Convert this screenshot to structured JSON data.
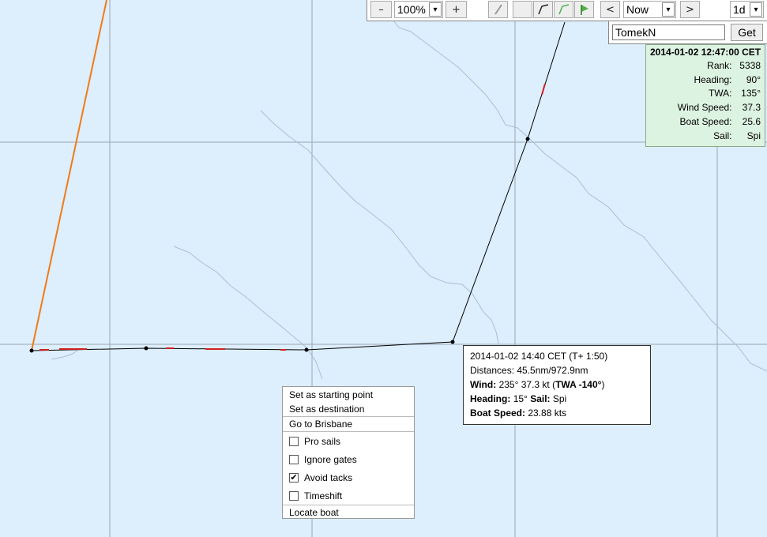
{
  "toolbar": {
    "zoom_out": "–",
    "zoom_value": "100%",
    "zoom_in": "+",
    "prev": "<",
    "time_value": "Now",
    "next": ">",
    "range_value": "1d",
    "select_arrow": "▾"
  },
  "boat_lookup": {
    "name_value": "TomekN",
    "get_label": "Get"
  },
  "boat_info": {
    "timestamp": "2014-01-02 12:47:00 CET",
    "rows": [
      {
        "label": "Rank:",
        "value": "5338"
      },
      {
        "label": "Heading:",
        "value": "90°"
      },
      {
        "label": "TWA:",
        "value": "135°"
      },
      {
        "label": "Wind Speed:",
        "value": "37.3"
      },
      {
        "label": "Boat Speed:",
        "value": "25.6"
      },
      {
        "label": "Sail:",
        "value": "Spi"
      }
    ]
  },
  "tooltip": {
    "line1": "2014-01-02 14:40 CET (T+ 1:50)",
    "distances_label": "Distances:",
    "distances_value": "45.5nm/972.9nm",
    "wind_label": "Wind:",
    "wind_value": "235° 37.3 kt (",
    "wind_twa": "TWA -140°",
    "wind_close": ")",
    "heading_label": "Heading:",
    "heading_value": "15°",
    "sail_label": "Sail:",
    "sail_value": "Spi",
    "speed_label": "Boat Speed:",
    "speed_value": "23.88 kts"
  },
  "context_menu": {
    "set_start": "Set as starting point",
    "set_dest": "Set as destination",
    "go_to": "Go to Brisbane",
    "pro_sails": {
      "label": "Pro sails",
      "checked": false
    },
    "ignore_gates": {
      "label": "Ignore gates",
      "checked": false
    },
    "avoid_tacks": {
      "label": "Avoid tacks",
      "checked": true
    },
    "timeshift": {
      "label": "Timeshift",
      "checked": false
    },
    "locate_boat": "Locate boat",
    "check_mark": "✔"
  },
  "colors": {
    "sea": "#ddeefc",
    "grid": "#9aa7b3",
    "river": "#a9bfd6",
    "route_orange": "#f07b16",
    "route_black": "#000000",
    "route_red": "#d11f1f",
    "info_bg": "#ddf3e1"
  }
}
